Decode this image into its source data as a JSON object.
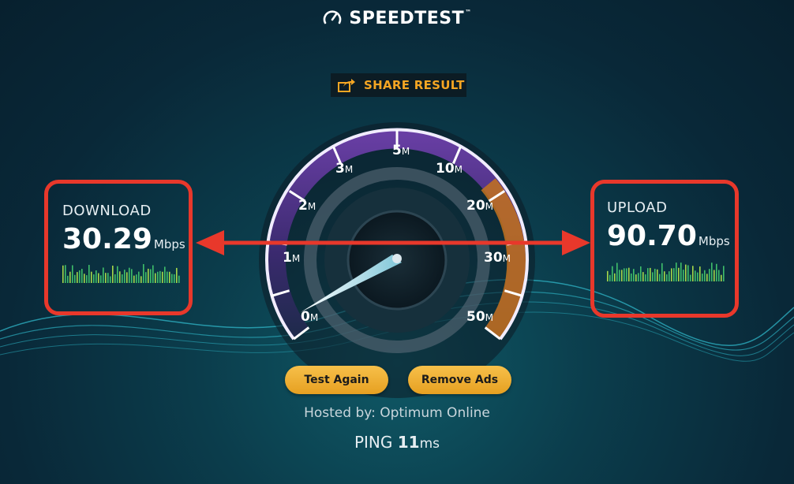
{
  "header": {
    "logo_text": "SPEEDTEST",
    "trademark": "™",
    "logo_icon": "gauge-icon"
  },
  "share": {
    "label": "SHARE RESULT",
    "icon": "share-icon",
    "color": "#f5a623"
  },
  "gauge": {
    "ticks": [
      {
        "value": "0",
        "unit": "M"
      },
      {
        "value": "1",
        "unit": "M"
      },
      {
        "value": "2",
        "unit": "M"
      },
      {
        "value": "3",
        "unit": "M"
      },
      {
        "value": "5",
        "unit": "M"
      },
      {
        "value": "10",
        "unit": "M"
      },
      {
        "value": "20",
        "unit": "M"
      },
      {
        "value": "30",
        "unit": "M"
      },
      {
        "value": "50",
        "unit": "M"
      }
    ]
  },
  "download": {
    "title": "DOWNLOAD",
    "value": "30.29",
    "unit": "Mbps"
  },
  "upload": {
    "title": "UPLOAD",
    "value": "90.70",
    "unit": "Mbps"
  },
  "buttons": {
    "test_again": "Test Again",
    "remove_ads": "Remove Ads"
  },
  "hosted": "Hosted by: Optimum Online",
  "ping": {
    "label": "PING",
    "value": "11",
    "unit": "ms"
  },
  "colors": {
    "annotation": "#e8382b",
    "button": "#f2b53a",
    "accent": "#f5a623"
  }
}
